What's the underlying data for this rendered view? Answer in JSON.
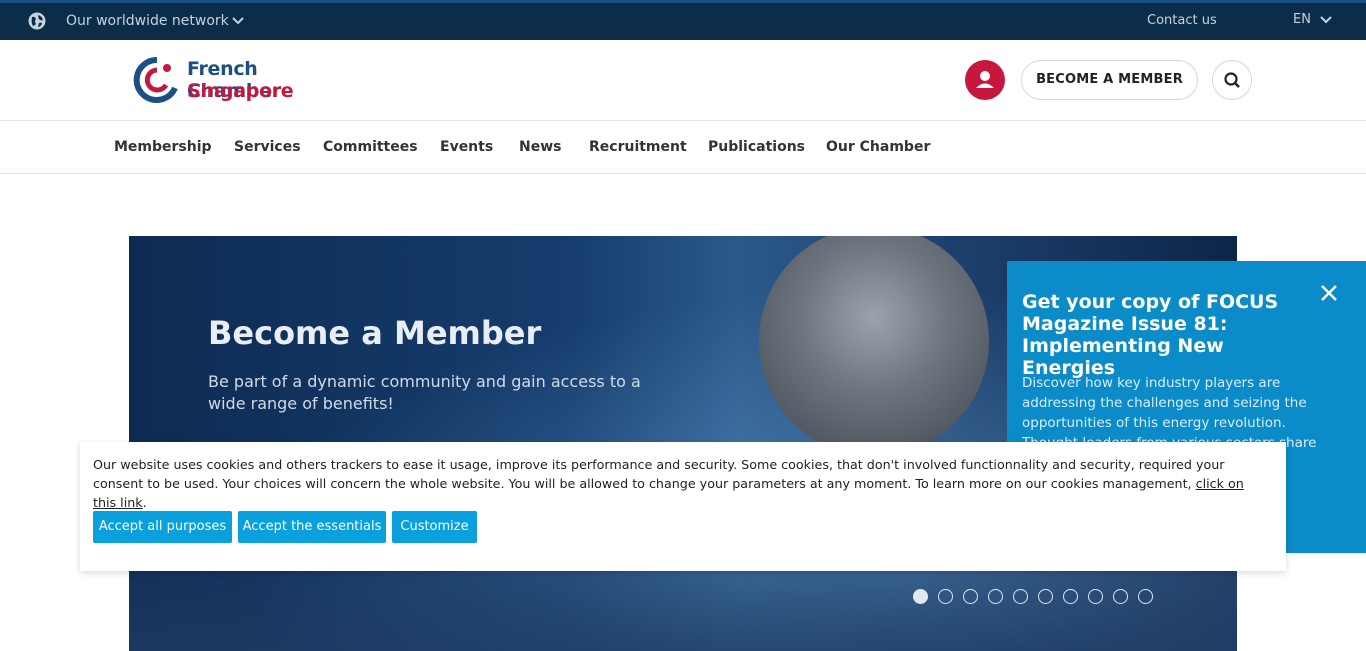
{
  "topbar": {
    "network_label": "Our worldwide network",
    "contact_label": "Contact us",
    "language": "EN",
    "icons": {
      "globe": "globe-icon",
      "chevron": "chevron-down-icon"
    }
  },
  "header": {
    "logo_line1": "French Chamber",
    "logo_line2": "Singapore",
    "become_member_label": "BECOME A MEMBER",
    "colors": {
      "brand_blue": "#1b4f86",
      "brand_red": "#c8173f"
    }
  },
  "nav": {
    "items": [
      "Membership",
      "Services",
      "Committees",
      "Events",
      "News",
      "Recruitment",
      "Publications",
      "Our Chamber"
    ]
  },
  "hero": {
    "title": "Become a Member",
    "subtitle": "Be part of a dynamic community and gain access to a wide range of benefits!",
    "slide_count": 10,
    "active_slide": 1
  },
  "focus_popup": {
    "title": "Get your copy of FOCUS Magazine Issue 81: Implementing New Energies",
    "body": "Discover how key industry players are addressing the challenges and seizing the opportunities of this energy revolution. Thought leaders from various sectors share their insights and",
    "color": "#0b8bc8"
  },
  "cookie_banner": {
    "text": "Our website uses cookies and others trackers to ease it usage, improve its performance and security. Some cookies, that don't involved functionnality and security, required your consent to be used. Your choices will concern the whole website. You will be allowed to change your parameters at any moment. To learn more on our cookies management, ",
    "link_text": "click on this link",
    "text_end": ".",
    "buttons": {
      "accept_all": "Accept all purposes",
      "accept_essentials": "Accept the essentials",
      "customize": "Customize"
    },
    "button_color": "#0aa0de"
  }
}
